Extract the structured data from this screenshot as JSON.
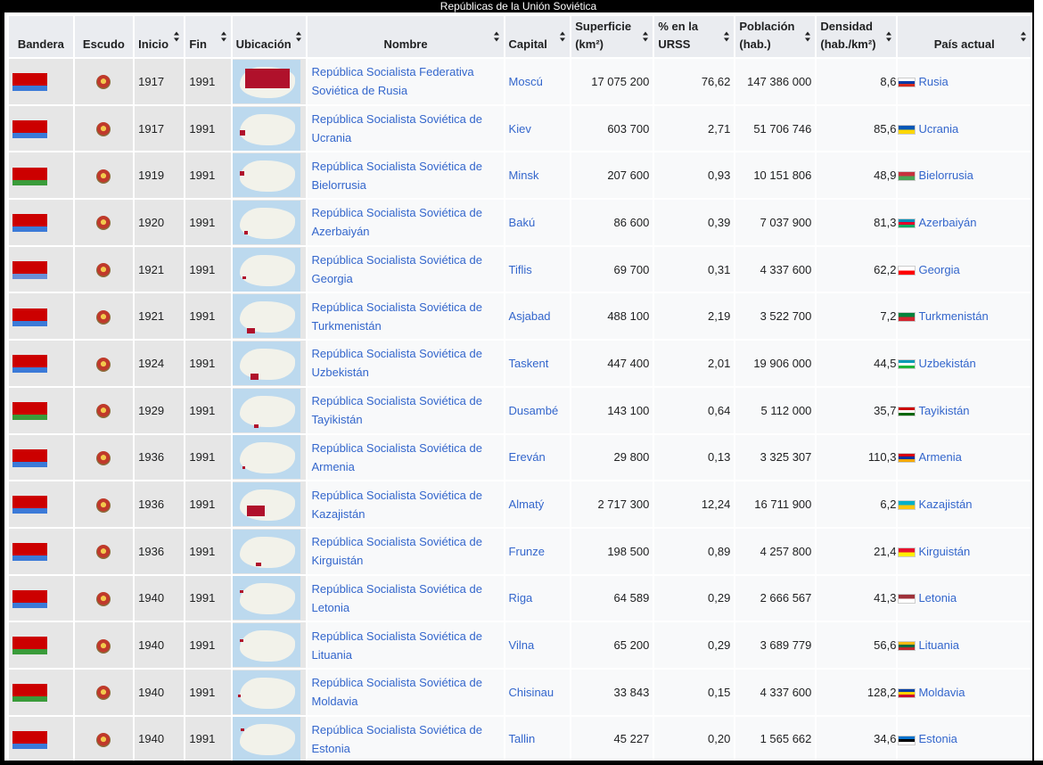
{
  "caption": "Repúblicas de la Unión Soviética",
  "columns": [
    "Bandera",
    "Escudo",
    "Inicio",
    "Fin",
    "Ubicación",
    "Nombre",
    "Capital",
    "Superficie (km²)",
    "% en la URSS",
    "Población (hab.)",
    "Densidad (hab./km²)",
    "País actual"
  ],
  "rows": [
    {
      "inicio": "1917",
      "fin": "1991",
      "nombre": "República Socialista Federativa Soviética de Rusia",
      "capital": "Moscú",
      "superficie": "17 075 200",
      "pct": "76,62",
      "poblacion": "147 386 000",
      "densidad": "8,6",
      "pais": "Rusia",
      "flag": [
        "#cc0000",
        "#3b7ad8"
      ],
      "country_flag": [
        "#ffffff",
        "#0039a6",
        "#d52b1e"
      ],
      "map": "russia"
    },
    {
      "inicio": "1917",
      "fin": "1991",
      "nombre": "República Socialista Soviética de Ucrania",
      "capital": "Kiev",
      "superficie": "603 700",
      "pct": "2,71",
      "poblacion": "51 706 746",
      "densidad": "85,6",
      "pais": "Ucrania",
      "flag": [
        "#cc0000",
        "#3b7ad8"
      ],
      "country_flag": [
        "#0057b7",
        "#ffd700"
      ],
      "map": "ukraine"
    },
    {
      "inicio": "1919",
      "fin": "1991",
      "nombre": "República Socialista Soviética de Bielorrusia",
      "capital": "Minsk",
      "superficie": "207 600",
      "pct": "0,93",
      "poblacion": "10 151 806",
      "densidad": "48,9",
      "pais": "Bielorrusia",
      "flag": [
        "#cc0000",
        "#3a9b3a"
      ],
      "country_flag": [
        "#c8313e",
        "#4aa657"
      ],
      "map": "belarus"
    },
    {
      "inicio": "1920",
      "fin": "1991",
      "nombre": "República Socialista Soviética de Azerbaiyán",
      "capital": "Bakú",
      "superficie": "86 600",
      "pct": "0,39",
      "poblacion": "7 037 900",
      "densidad": "81,3",
      "pais": "Azerbaiyán",
      "flag": [
        "#cc0000",
        "#3b7ad8"
      ],
      "country_flag": [
        "#0092bc",
        "#e4002b",
        "#00af66"
      ],
      "map": "azerbaijan"
    },
    {
      "inicio": "1921",
      "fin": "1991",
      "nombre": "República Socialista Soviética de Georgia",
      "capital": "Tiflis",
      "superficie": "69 700",
      "pct": "0,31",
      "poblacion": "4 337 600",
      "densidad": "62,2",
      "pais": "Georgia",
      "flag": [
        "#cc0000",
        "#6a8fd8"
      ],
      "country_flag": [
        "#ffffff",
        "#ff0000"
      ],
      "map": "georgia"
    },
    {
      "inicio": "1921",
      "fin": "1991",
      "nombre": "República Socialista Soviética de Turkmenistán",
      "capital": "Asjabad",
      "superficie": "488 100",
      "pct": "2,19",
      "poblacion": "3 522 700",
      "densidad": "7,2",
      "pais": "Turkmenistán",
      "flag": [
        "#cc0000",
        "#3b7ad8"
      ],
      "country_flag": [
        "#00843d",
        "#d22630"
      ],
      "map": "turkmenistan"
    },
    {
      "inicio": "1924",
      "fin": "1991",
      "nombre": "República Socialista Soviética de Uzbekistán",
      "capital": "Taskent",
      "superficie": "447 400",
      "pct": "2,01",
      "poblacion": "19 906 000",
      "densidad": "44,5",
      "pais": "Uzbekistán",
      "flag": [
        "#cc0000",
        "#3b7ad8"
      ],
      "country_flag": [
        "#0099b5",
        "#ffffff",
        "#1eb53a"
      ],
      "map": "uzbekistan"
    },
    {
      "inicio": "1929",
      "fin": "1991",
      "nombre": "República Socialista Soviética de Tayikistán",
      "capital": "Dusambé",
      "superficie": "143 100",
      "pct": "0,64",
      "poblacion": "5 112 000",
      "densidad": "35,7",
      "pais": "Tayikistán",
      "flag": [
        "#cc0000",
        "#3a9b3a"
      ],
      "country_flag": [
        "#cc0000",
        "#ffffff",
        "#006600"
      ],
      "map": "tajikistan"
    },
    {
      "inicio": "1936",
      "fin": "1991",
      "nombre": "República Socialista Soviética de Armenia",
      "capital": "Ereván",
      "superficie": "29 800",
      "pct": "0,13",
      "poblacion": "3 325 307",
      "densidad": "110,3",
      "pais": "Armenia",
      "flag": [
        "#cc0000",
        "#3b7ad8"
      ],
      "country_flag": [
        "#d90012",
        "#0033a0",
        "#f2a800"
      ],
      "map": "armenia"
    },
    {
      "inicio": "1936",
      "fin": "1991",
      "nombre": "República Socialista Soviética de Kazajistán",
      "capital": "Almatý",
      "superficie": "2 717 300",
      "pct": "12,24",
      "poblacion": "16 711 900",
      "densidad": "6,2",
      "pais": "Kazajistán",
      "flag": [
        "#cc0000",
        "#3b7ad8"
      ],
      "country_flag": [
        "#00afca",
        "#fec50c"
      ],
      "map": "kazakhstan"
    },
    {
      "inicio": "1936",
      "fin": "1991",
      "nombre": "República Socialista Soviética de Kirguistán",
      "capital": "Frunze",
      "superficie": "198 500",
      "pct": "0,89",
      "poblacion": "4 257 800",
      "densidad": "21,4",
      "pais": "Kirguistán",
      "flag": [
        "#cc0000",
        "#3b7ad8"
      ],
      "country_flag": [
        "#e8112d",
        "#ffef00"
      ],
      "map": "kyrgyzstan"
    },
    {
      "inicio": "1940",
      "fin": "1991",
      "nombre": "República Socialista Soviética de Letonia",
      "capital": "Riga",
      "superficie": "64 589",
      "pct": "0,29",
      "poblacion": "2 666 567",
      "densidad": "41,3",
      "pais": "Letonia",
      "flag": [
        "#cc0000",
        "#3b7ad8"
      ],
      "country_flag": [
        "#9e3039",
        "#ffffff"
      ],
      "map": "latvia"
    },
    {
      "inicio": "1940",
      "fin": "1991",
      "nombre": "República Socialista Soviética de Lituania",
      "capital": "Vilna",
      "superficie": "65 200",
      "pct": "0,29",
      "poblacion": "3 689 779",
      "densidad": "56,6",
      "pais": "Lituania",
      "flag": [
        "#cc0000",
        "#3a9b3a"
      ],
      "country_flag": [
        "#fdb913",
        "#006a44",
        "#c1272d"
      ],
      "map": "lithuania"
    },
    {
      "inicio": "1940",
      "fin": "1991",
      "nombre": "República Socialista Soviética de Moldavia",
      "capital": "Chisinau",
      "superficie": "33 843",
      "pct": "0,15",
      "poblacion": "4 337 600",
      "densidad": "128,2",
      "pais": "Moldavia",
      "flag": [
        "#cc0000",
        "#3a9b3a"
      ],
      "country_flag": [
        "#003da5",
        "#ffd200",
        "#cc092f"
      ],
      "map": "moldova"
    },
    {
      "inicio": "1940",
      "fin": "1991",
      "nombre": "República Socialista Soviética de Estonia",
      "capital": "Tallin",
      "superficie": "45 227",
      "pct": "0,20",
      "poblacion": "1 565 662",
      "densidad": "34,6",
      "pais": "Estonia",
      "flag": [
        "#cc0000",
        "#3b7ad8"
      ],
      "country_flag": [
        "#0072ce",
        "#000000",
        "#ffffff"
      ],
      "map": "estonia"
    }
  ]
}
